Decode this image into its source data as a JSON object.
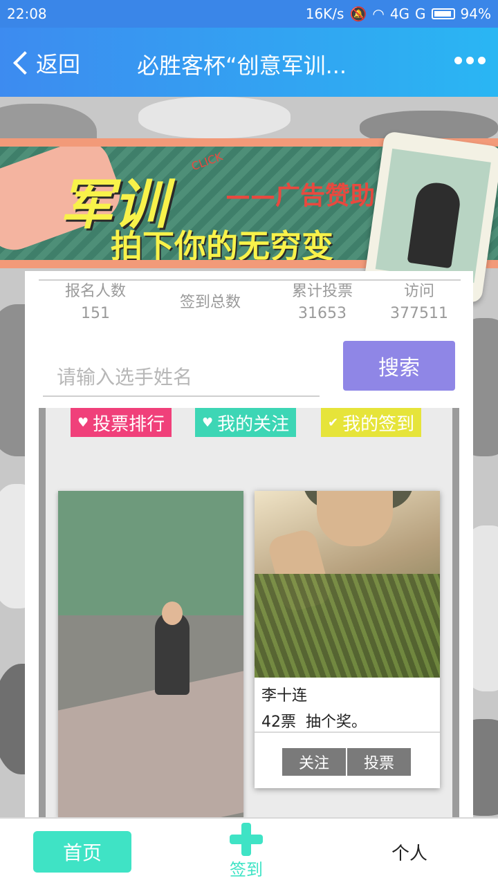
{
  "statusbar": {
    "time": "22:08",
    "net_speed": "16K/s",
    "signal": "4G",
    "signal2": "G",
    "battery": "94%"
  },
  "header": {
    "back_label": "返回",
    "title": "必胜客杯“创意军训...",
    "more_icon": "more-dots-icon"
  },
  "banner": {
    "headline": "军训",
    "sponsor": "——广告赞助",
    "slogan": "拍下你的无穷变",
    "click_text": "CLICK"
  },
  "stats": [
    {
      "label": "报名人数",
      "value": "151"
    },
    {
      "label": "签到总数",
      "value": ""
    },
    {
      "label": "累计投票",
      "value": "31653"
    },
    {
      "label": "访问",
      "value": "377511"
    }
  ],
  "search": {
    "placeholder": "请输入选手姓名",
    "button_label": "搜索"
  },
  "tabs": [
    {
      "label": "投票排行",
      "icon": "heart-icon",
      "color": "#f0407a"
    },
    {
      "label": "我的关注",
      "icon": "heart-icon",
      "color": "#3dd6b5"
    },
    {
      "label": "我的签到",
      "icon": "check-icon",
      "color": "#e6e43a"
    }
  ],
  "entry": {
    "name": "李十连",
    "votes_line": "42票  抽个奖。",
    "follow_label": "关注",
    "vote_label": "投票"
  },
  "bottomnav": {
    "home": "首页",
    "checkin": "签到",
    "personal": "个人",
    "accent": "#3fe3c5"
  }
}
